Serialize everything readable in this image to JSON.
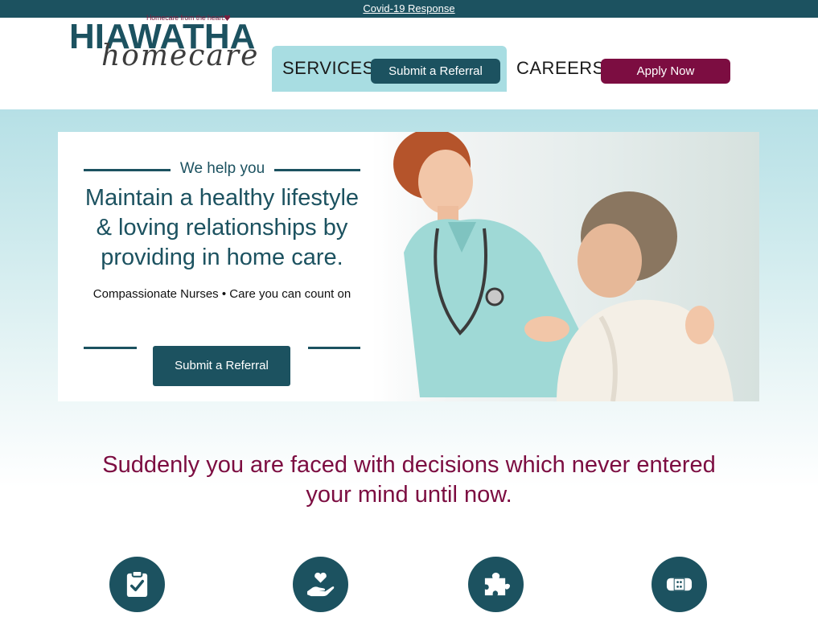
{
  "topbar": {
    "link": "Covid-19 Response"
  },
  "logo": {
    "tagline": "Homecare from the heart.",
    "name": "HIAWATHA",
    "script": "homecare"
  },
  "nav": {
    "services": "SERVICES",
    "submit_referral": "Submit a Referral",
    "careers": "CAREERS",
    "apply_now": "Apply Now"
  },
  "hero": {
    "kicker": "We help you",
    "title": "Maintain a healthy lifestyle & loving relationships by providing in home care.",
    "subtitle": "Compassionate Nurses • Care you can count on",
    "cta": "Submit a Referral"
  },
  "section": {
    "headline": "Suddenly you are faced with decisions which never entered your mind until now."
  },
  "features": [
    {
      "icon": "clipboard-check-icon"
    },
    {
      "icon": "hand-heart-icon"
    },
    {
      "icon": "puzzle-piece-icon"
    },
    {
      "icon": "bandage-icon"
    }
  ],
  "colors": {
    "teal": "#1c5260",
    "maroon": "#7c0d41",
    "light_teal": "#a8dde2"
  }
}
